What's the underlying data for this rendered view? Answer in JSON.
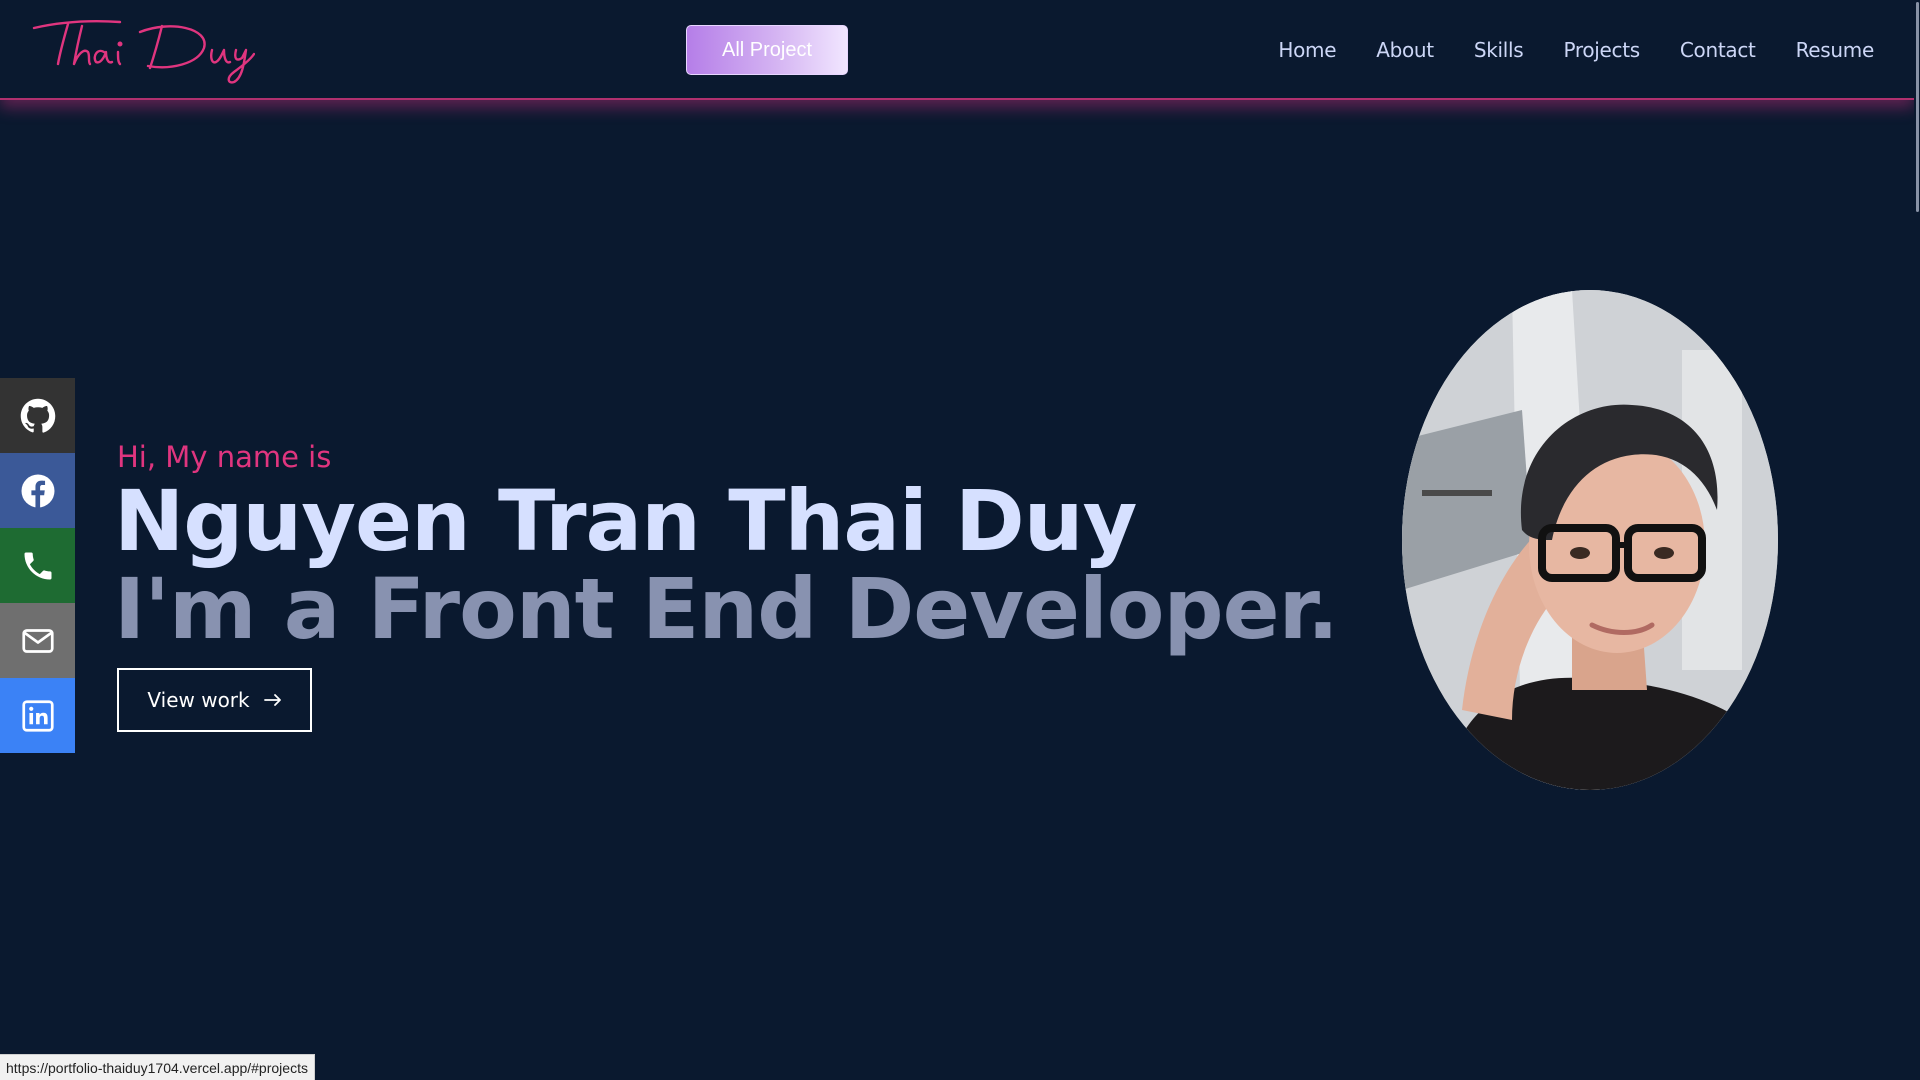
{
  "header": {
    "logo_text": "Thai Duy",
    "all_project_label": "All Project",
    "nav": [
      {
        "label": "Home"
      },
      {
        "label": "About"
      },
      {
        "label": "Skills"
      },
      {
        "label": "Projects"
      },
      {
        "label": "Contact"
      },
      {
        "label": "Resume"
      }
    ]
  },
  "social": [
    {
      "icon": "github-icon",
      "color": "#333333"
    },
    {
      "icon": "facebook-icon",
      "color": "#3b5998"
    },
    {
      "icon": "phone-icon",
      "color": "#1e6b32"
    },
    {
      "icon": "mail-icon",
      "color": "#6f6f6f"
    },
    {
      "icon": "linkedin-icon",
      "color": "#3b82f6"
    }
  ],
  "hero": {
    "intro": "Hi, My name is",
    "name": "Nguyen Tran Thai Duy",
    "role": "I'm a Front End Developer.",
    "cta_label": "View work"
  },
  "status_bar": {
    "url": "https://portfolio-thaiduy1704.vercel.app/#projects"
  },
  "colors": {
    "background": "#0a192f",
    "accent_pink": "#e0357f",
    "name_text": "#d6e0ff",
    "role_text": "#8892b0"
  }
}
